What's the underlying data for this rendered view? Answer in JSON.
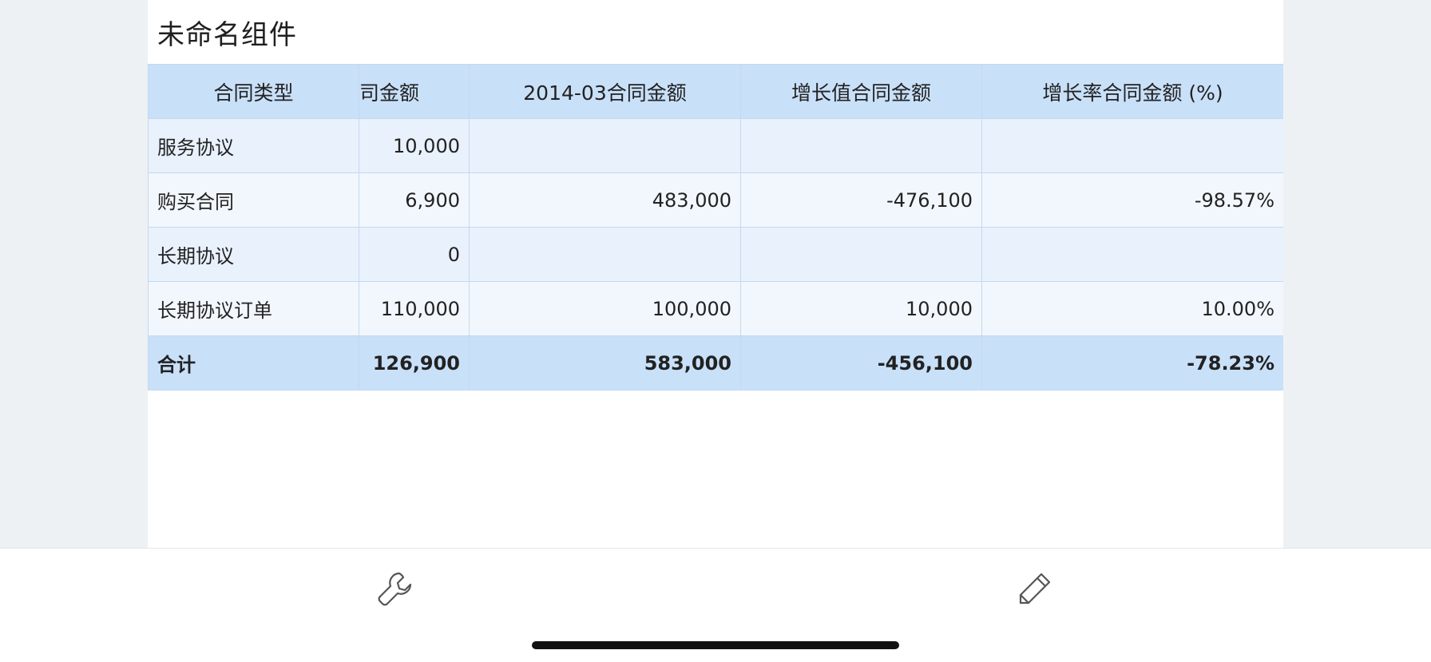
{
  "widget": {
    "title": "未命名组件"
  },
  "table": {
    "headers": [
      "合同类型",
      "司金额",
      "2014-03合同金额",
      "增长值合同金额",
      "增长率合同金额 (%)"
    ],
    "rows": [
      [
        "服务协议",
        "10,000",
        "",
        "",
        ""
      ],
      [
        "购买合同",
        "6,900",
        "483,000",
        "-476,100",
        "-98.57%"
      ],
      [
        "长期协议",
        "0",
        "",
        "",
        ""
      ],
      [
        "长期协议订单",
        "110,000",
        "100,000",
        "10,000",
        "10.00%"
      ]
    ],
    "total": [
      "合计",
      "126,900",
      "583,000",
      "-456,100",
      "-78.23%"
    ]
  },
  "toolbar": {
    "wrench_icon": "wrench-icon",
    "pencil_icon": "pencil-icon"
  },
  "colors": {
    "header_bg": "#c9e0f9",
    "row_odd_bg": "#e8f1fc",
    "row_even_bg": "#f2f7fd",
    "grid_border": "#c4d9ee",
    "page_bg": "#eef1f4"
  }
}
